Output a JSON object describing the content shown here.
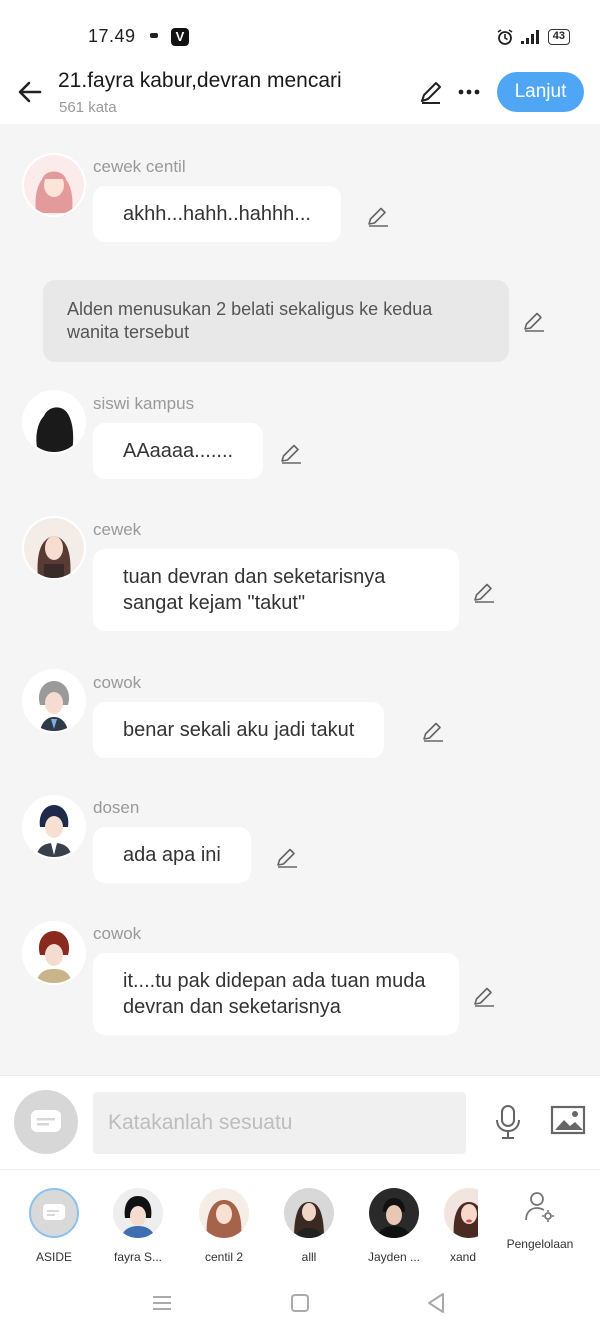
{
  "status_bar": {
    "time": "17.49",
    "app_badge": "V",
    "battery": "43"
  },
  "header": {
    "title": "21.fayra kabur,devran mencari",
    "word_count": "561 kata",
    "next_label": "Lanjut"
  },
  "messages": [
    {
      "name": "cewek centil",
      "text": "akhh...hahh..hahhh..."
    },
    {
      "narration": "Alden menusukan 2 belati sekaligus ke kedua wanita tersebut"
    },
    {
      "name": "siswi kampus",
      "text": "AAaaaa......."
    },
    {
      "name": "cewek",
      "text": "tuan devran dan seketarisnya sangat kejam \"takut\""
    },
    {
      "name": "cowok",
      "text": "benar sekali aku jadi takut"
    },
    {
      "name": "dosen",
      "text": "ada apa ini"
    },
    {
      "name": "cowok",
      "text": "it....tu pak didepan ada tuan muda devran dan seketarisnya"
    }
  ],
  "input": {
    "placeholder": "Katakanlah sesuatu"
  },
  "characters": [
    {
      "label": "ASIDE"
    },
    {
      "label": "fayra S..."
    },
    {
      "label": "centil 2"
    },
    {
      "label": "alll"
    },
    {
      "label": "Jayden ..."
    },
    {
      "label": "xand"
    }
  ],
  "manage_label": "Pengelolaan",
  "colors": {
    "accent": "#4ea6f5",
    "background": "#f5f5f5",
    "narration_bg": "#e8e8e8"
  }
}
